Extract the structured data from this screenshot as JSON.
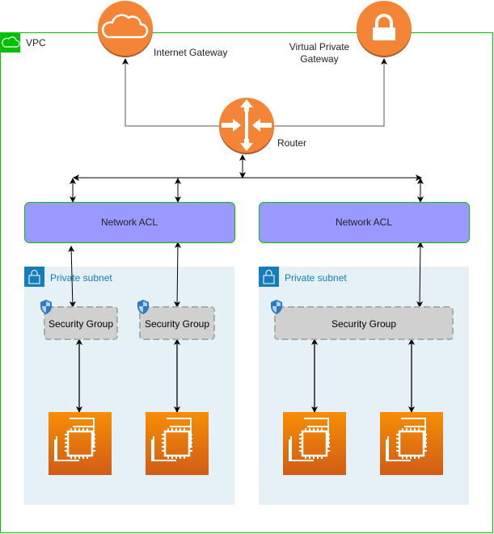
{
  "vpc": {
    "label": "VPC",
    "border_color": "#00c000"
  },
  "internet_gateway": {
    "label": "Internet Gateway",
    "icon": "cloud-icon"
  },
  "virtual_private_gateway": {
    "label": "Virtual Private Gateway",
    "icon": "lock-icon"
  },
  "router": {
    "label": "Router",
    "icon": "router-icon"
  },
  "network_acls": [
    {
      "label": "Network ACL"
    },
    {
      "label": "Network ACL"
    }
  ],
  "subnets": [
    {
      "label": "Private subnet"
    },
    {
      "label": "Private subnet"
    }
  ],
  "security_groups": [
    {
      "label": "Security Group"
    },
    {
      "label": "Security Group"
    },
    {
      "label": "Security Group"
    }
  ],
  "instances": [
    {
      "icon": "ec2-instance-icon"
    },
    {
      "icon": "ec2-instance-icon"
    },
    {
      "icon": "ec2-instance-icon"
    },
    {
      "icon": "ec2-instance-icon"
    }
  ],
  "colors": {
    "orange": "#f58536",
    "nacl_fill": "#9999ff",
    "subnet_fill": "#e6f0f7",
    "sg_fill": "#d0d0d0",
    "subnet_accent": "#147eba"
  }
}
